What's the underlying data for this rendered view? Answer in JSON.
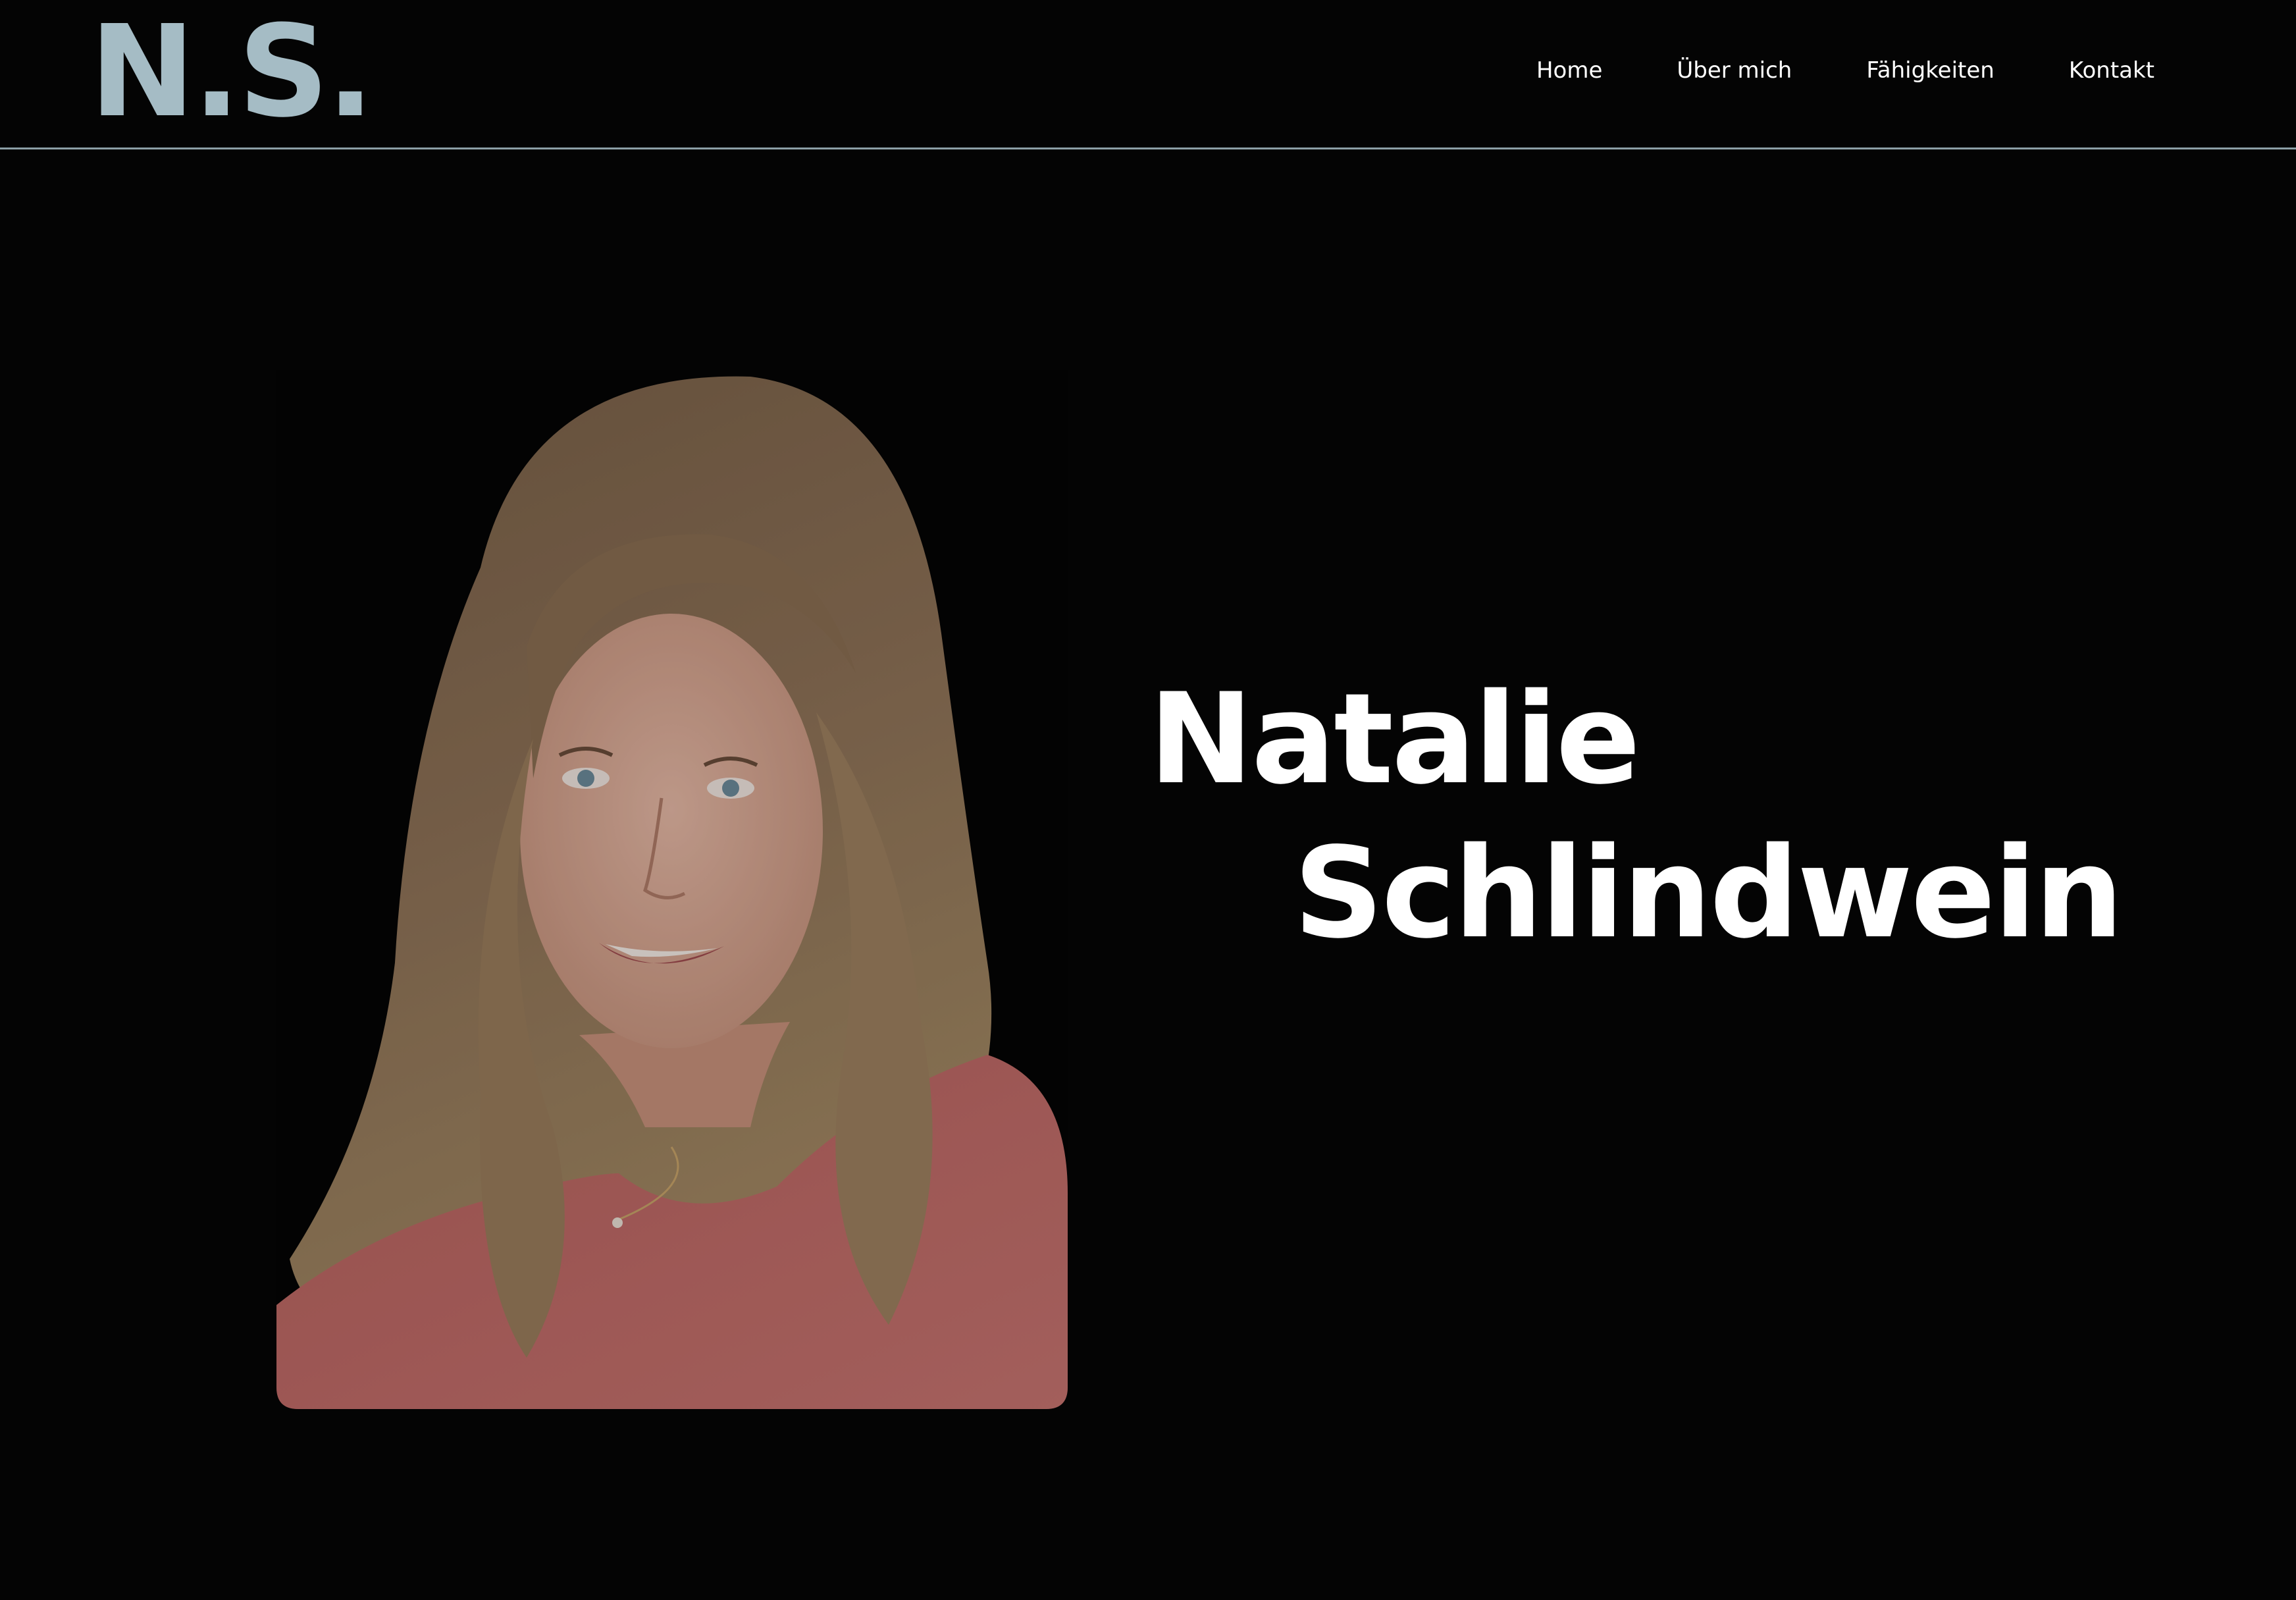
{
  "header": {
    "logo": "N.S.",
    "nav": [
      {
        "label": "Home"
      },
      {
        "label": "Über mich"
      },
      {
        "label": "Fähigkeiten"
      },
      {
        "label": "Kontakt"
      }
    ]
  },
  "hero": {
    "first_name": "Natalie",
    "last_name": "Schlindwein"
  },
  "colors": {
    "background": "#040404",
    "logo": "#a5bcc5",
    "divider": "#8c9fa6",
    "text": "#ffffff",
    "shirt": "#c06a66",
    "hair": "#8a7055"
  }
}
